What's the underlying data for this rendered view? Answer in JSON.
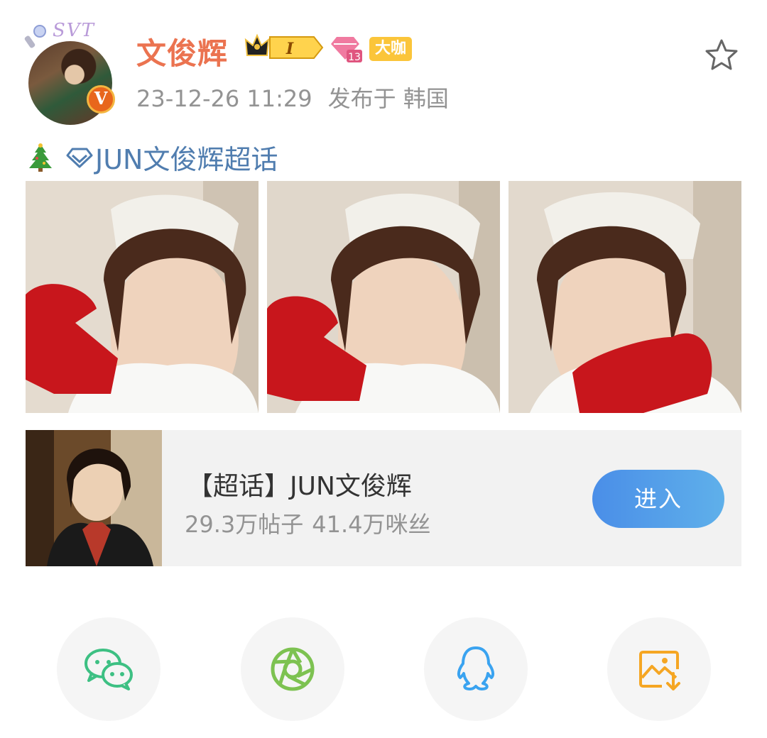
{
  "post": {
    "author_name": "文俊辉",
    "member_level": "I",
    "fan_level": "13",
    "dk_badge": "大咖",
    "avatar_deco_text": "SVT",
    "date": "23-12-26 11:29",
    "location": "发布于 韩国",
    "topic_emoji_icon": "christmas-tree-icon",
    "topic_link": "JUN文俊辉超话"
  },
  "photos": [
    {
      "description_icon": "photo-1"
    },
    {
      "description_icon": "photo-2"
    },
    {
      "description_icon": "photo-3"
    }
  ],
  "super_topic_card": {
    "title": "【超话】JUN文俊辉",
    "posts_count": "29.3万帖子",
    "fans_count": "41.4万咪丝",
    "enter_label": "进入"
  },
  "share_buttons": [
    {
      "name": "wechat",
      "icon": "wechat-icon",
      "color": "#3dc083"
    },
    {
      "name": "moments",
      "icon": "wechat-moments-icon",
      "color": "#7dc251"
    },
    {
      "name": "qq",
      "icon": "qq-icon",
      "color": "#3aa3f0"
    },
    {
      "name": "save-image",
      "icon": "save-image-icon",
      "color": "#f5a623"
    }
  ],
  "colors": {
    "username": "#eb7350",
    "topic": "#507daf",
    "meta_text": "#939393",
    "button": "#4a8ee8"
  }
}
